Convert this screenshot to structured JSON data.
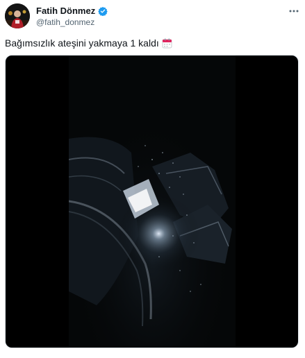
{
  "tweet": {
    "author": {
      "display_name": "Fatih Dönmez",
      "handle": "@fatih_donmez",
      "verified": true,
      "verified_color": "#1d9bf0"
    },
    "text": "Bağımsızlık ateşini yakmaya 1 kaldı",
    "text_emoji": "calendar-icon",
    "more_icon": "more-horizontal-icon",
    "media": {
      "kind": "video-still",
      "description_icon": "video-frame"
    }
  },
  "colors": {
    "text_primary": "#0f1419",
    "text_secondary": "#536471",
    "media_bg": "#000000"
  }
}
